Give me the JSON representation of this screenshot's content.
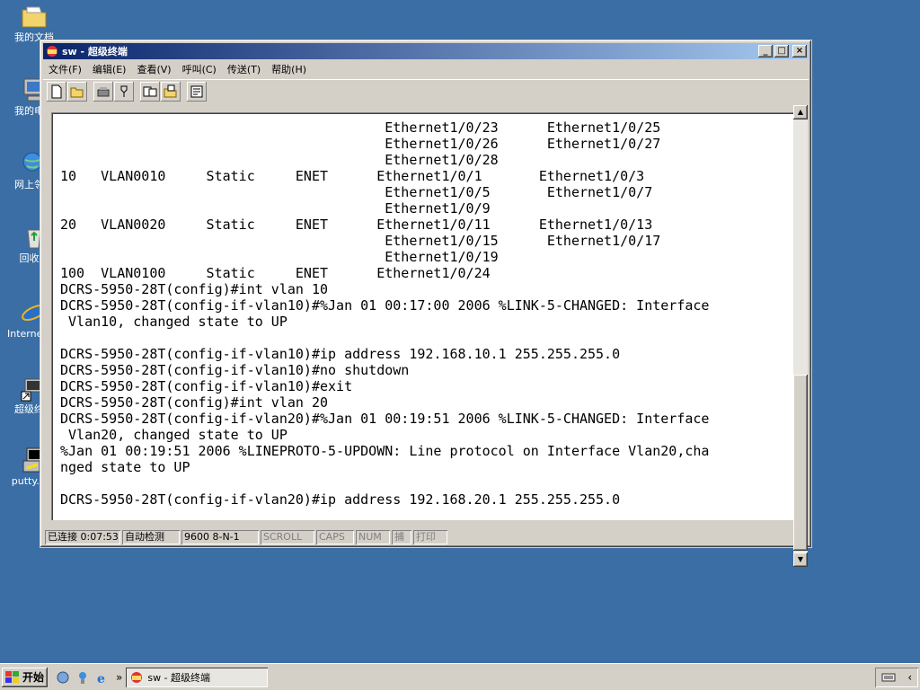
{
  "desktop": {
    "icons": [
      {
        "label": "我的文档",
        "icon": "folder-icon"
      },
      {
        "label": "我的电脑",
        "icon": "computer-icon"
      },
      {
        "label": "网上邻居",
        "icon": "network-icon"
      },
      {
        "label": "回收站",
        "icon": "recycle-bin-icon"
      },
      {
        "label": "Internet Explorer",
        "icon": "ie-icon"
      },
      {
        "label": "超级终端",
        "icon": "shortcut-icon"
      },
      {
        "label": "putty.exe",
        "icon": "putty-icon"
      }
    ]
  },
  "window": {
    "title": "sw - 超级终端",
    "buttons": {
      "minimize": "_",
      "maximize": "□",
      "close": "×"
    },
    "menu": [
      "文件(F)",
      "编辑(E)",
      "查看(V)",
      "呼叫(C)",
      "传送(T)",
      "帮助(H)"
    ],
    "terminal_lines": [
      "                                        Ethernet1/0/23      Ethernet1/0/25",
      "                                        Ethernet1/0/26      Ethernet1/0/27",
      "                                        Ethernet1/0/28",
      "10   VLAN0010     Static     ENET      Ethernet1/0/1       Ethernet1/0/3",
      "                                        Ethernet1/0/5       Ethernet1/0/7",
      "                                        Ethernet1/0/9",
      "20   VLAN0020     Static     ENET      Ethernet1/0/11      Ethernet1/0/13",
      "                                        Ethernet1/0/15      Ethernet1/0/17",
      "                                        Ethernet1/0/19",
      "100  VLAN0100     Static     ENET      Ethernet1/0/24",
      "DCRS-5950-28T(config)#int vlan 10",
      "DCRS-5950-28T(config-if-vlan10)#%Jan 01 00:17:00 2006 %LINK-5-CHANGED: Interface",
      " Vlan10, changed state to UP",
      "",
      "DCRS-5950-28T(config-if-vlan10)#ip address 192.168.10.1 255.255.255.0",
      "DCRS-5950-28T(config-if-vlan10)#no shutdown",
      "DCRS-5950-28T(config-if-vlan10)#exit",
      "DCRS-5950-28T(config)#int vlan 20",
      "DCRS-5950-28T(config-if-vlan20)#%Jan 01 00:19:51 2006 %LINK-5-CHANGED: Interface",
      " Vlan20, changed state to UP",
      "%Jan 01 00:19:51 2006 %LINEPROTO-5-UPDOWN: Line protocol on Interface Vlan20,cha",
      "nged state to UP",
      "",
      "DCRS-5950-28T(config-if-vlan20)#ip address 192.168.20.1 255.255.255.0"
    ],
    "status": {
      "connected": "已连接 0:07:53",
      "detect": "自动检测",
      "port": "9600 8-N-1",
      "scroll": "SCROLL",
      "caps": "CAPS",
      "num": "NUM",
      "capture": "捕",
      "print": "打印"
    }
  },
  "taskbar": {
    "start": "开始",
    "chevron": "»",
    "task": "sw - 超级终端"
  }
}
